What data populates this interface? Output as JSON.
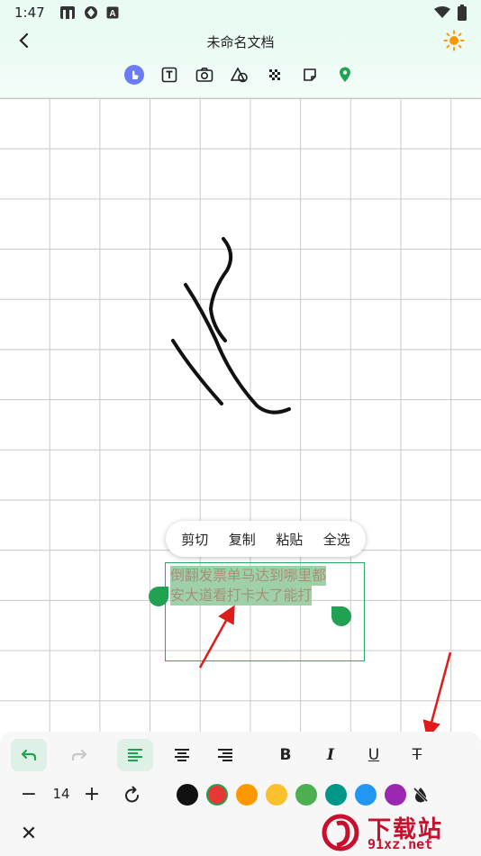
{
  "status_bar": {
    "time": "1:47",
    "icons": [
      "gallery-icon",
      "shutter-icon",
      "app-a-icon"
    ],
    "right_icons": [
      "wifi-icon",
      "battery-icon"
    ]
  },
  "header": {
    "title": "未命名文档",
    "back_icon": "chevron-left-icon",
    "theme_icon": "sun-icon"
  },
  "toolbar": {
    "tools": [
      "hand-touch-icon",
      "text-icon",
      "camera-icon",
      "shapes-icon",
      "mosaic-icon",
      "sticky-note-icon",
      "location-pin-icon"
    ],
    "active_tool": "hand-touch-icon",
    "accent": "#6a7cf0"
  },
  "context_menu": {
    "items": [
      "剪切",
      "复制",
      "粘贴",
      "全选"
    ]
  },
  "text_box": {
    "lines": [
      "倒翻发票单马达到哪里都",
      "安大道看打卡大了能打"
    ]
  },
  "format_bar": {
    "bold": "B",
    "italic": "I",
    "underline": "U",
    "strike": "T",
    "font_size": "14",
    "minus": "−",
    "plus": "+",
    "close": "✕",
    "colors": [
      "#111111",
      "#e53935",
      "#ff9800",
      "#fbc02d",
      "#4caf50",
      "#009688",
      "#2196f3",
      "#9c27b0"
    ],
    "selected_color": "#e53935"
  },
  "watermark": {
    "text_cn": "下载站",
    "text_url": "91xz.net"
  }
}
